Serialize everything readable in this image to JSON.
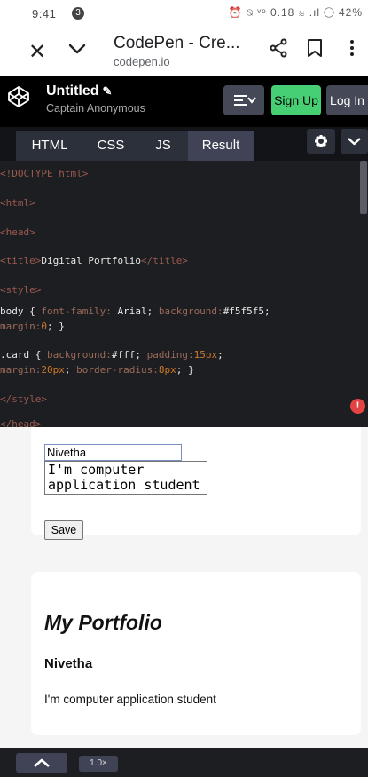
{
  "status_bar": {
    "time": "9:41",
    "notification_count": "3",
    "right_icons": "⏰ ⍉ ᵛᵒ 0.18 ≋ .ıl ◯ 42%"
  },
  "browser": {
    "title": "CodePen - Cre...",
    "url": "codepen.io"
  },
  "codepen": {
    "pen_title": "Untitled",
    "author": "Captain Anonymous",
    "signup_label": "Sign Up",
    "login_label": "Log In"
  },
  "tabs": [
    {
      "label": "HTML"
    },
    {
      "label": "CSS"
    },
    {
      "label": "JS"
    },
    {
      "label": "Result"
    }
  ],
  "code_lines": [
    {
      "parts": [
        {
          "t": "<!DOCTYPE html>",
          "c": "tag"
        }
      ]
    },
    {
      "parts": [
        {
          "t": "<html>",
          "c": "tag"
        }
      ]
    },
    {
      "parts": [
        {
          "t": "<head>",
          "c": "tag"
        }
      ]
    },
    {
      "parts": [
        {
          "t": "  <title>",
          "c": "tag"
        },
        {
          "t": "Digital Portfolio",
          "c": "txt"
        },
        {
          "t": "</title>",
          "c": "tag"
        }
      ]
    },
    {
      "parts": [
        {
          "t": "  <style>",
          "c": "tag"
        }
      ]
    },
    {
      "parts": [
        {
          "t": "    body { ",
          "c": "txt"
        },
        {
          "t": "font-family: ",
          "c": "prop"
        },
        {
          "t": "Arial",
          "c": "txt"
        },
        {
          "t": "; ",
          "c": "txt"
        },
        {
          "t": "background:",
          "c": "prop"
        },
        {
          "t": "#f5f5f5",
          "c": "txt"
        },
        {
          "t": ";",
          "c": "txt"
        }
      ]
    },
    {
      "parts": [
        {
          "t": "margin:",
          "c": "prop"
        },
        {
          "t": "0",
          "c": "num"
        },
        {
          "t": "; }",
          "c": "txt"
        }
      ]
    },
    {
      "parts": [
        {
          "t": "    .card { ",
          "c": "txt"
        },
        {
          "t": "background:",
          "c": "prop"
        },
        {
          "t": "#fff",
          "c": "txt"
        },
        {
          "t": "; ",
          "c": "txt"
        },
        {
          "t": "padding:",
          "c": "prop"
        },
        {
          "t": "15px",
          "c": "num"
        },
        {
          "t": ";",
          "c": "txt"
        }
      ]
    },
    {
      "parts": [
        {
          "t": "margin:",
          "c": "prop"
        },
        {
          "t": "20px",
          "c": "num"
        },
        {
          "t": "; ",
          "c": "txt"
        },
        {
          "t": "border-radius:",
          "c": "prop"
        },
        {
          "t": "8px",
          "c": "num"
        },
        {
          "t": "; }",
          "c": "txt"
        }
      ]
    },
    {
      "parts": [
        {
          "t": "  </style>",
          "c": "tag"
        }
      ]
    },
    {
      "parts": [
        {
          "t": "</head>",
          "c": "tag"
        }
      ]
    }
  ],
  "result": {
    "name_value": "Nivetha",
    "about_value": "I'm computer\napplication student",
    "save_label": "Save",
    "portfolio_title": "My Portfolio",
    "portfolio_name": "Nivetha",
    "portfolio_about": "I'm computer application student"
  },
  "footer": {
    "zoom_label": "1.0×"
  },
  "alert_label": "!",
  "colors": {
    "signup_green": "#47cf73",
    "alert_red": "#e34343",
    "editor_bg": "#1d1e22"
  }
}
